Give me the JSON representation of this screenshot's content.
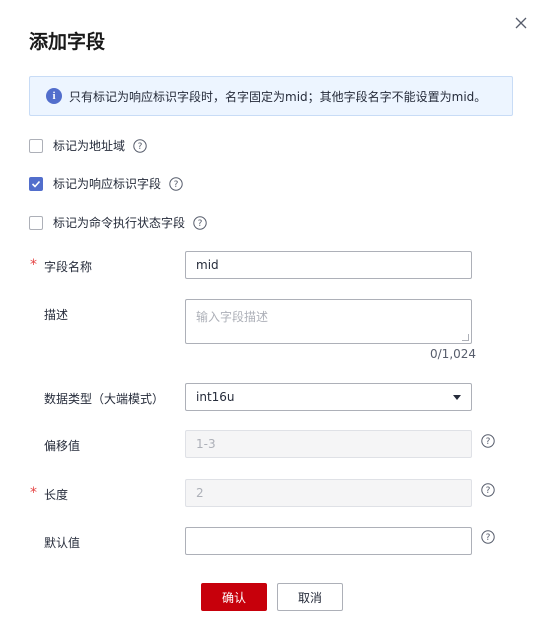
{
  "dialog": {
    "title": "添加字段",
    "notice": "只有标记为响应标识字段时，名字固定为mid；其他字段名字不能设置为mid。"
  },
  "checkboxes": [
    {
      "label": "标记为地址域",
      "checked": false
    },
    {
      "label": "标记为响应标识字段",
      "checked": true
    },
    {
      "label": "标记为命令执行状态字段",
      "checked": false
    }
  ],
  "form": {
    "name_label": "字段名称",
    "name_value": "mid",
    "desc_label": "描述",
    "desc_placeholder": "输入字段描述",
    "desc_counter": "0/1,024",
    "type_label": "数据类型（大端模式）",
    "type_value": "int16u",
    "offset_label": "偏移值",
    "offset_value": "1-3",
    "length_label": "长度",
    "length_value": "2",
    "default_label": "默认值",
    "default_value": ""
  },
  "buttons": {
    "ok": "确认",
    "cancel": "取消"
  },
  "colors": {
    "primary": "#c7000b",
    "accent": "#526ecc",
    "notice_bg": "#edf5ff",
    "required": "#e54545"
  }
}
